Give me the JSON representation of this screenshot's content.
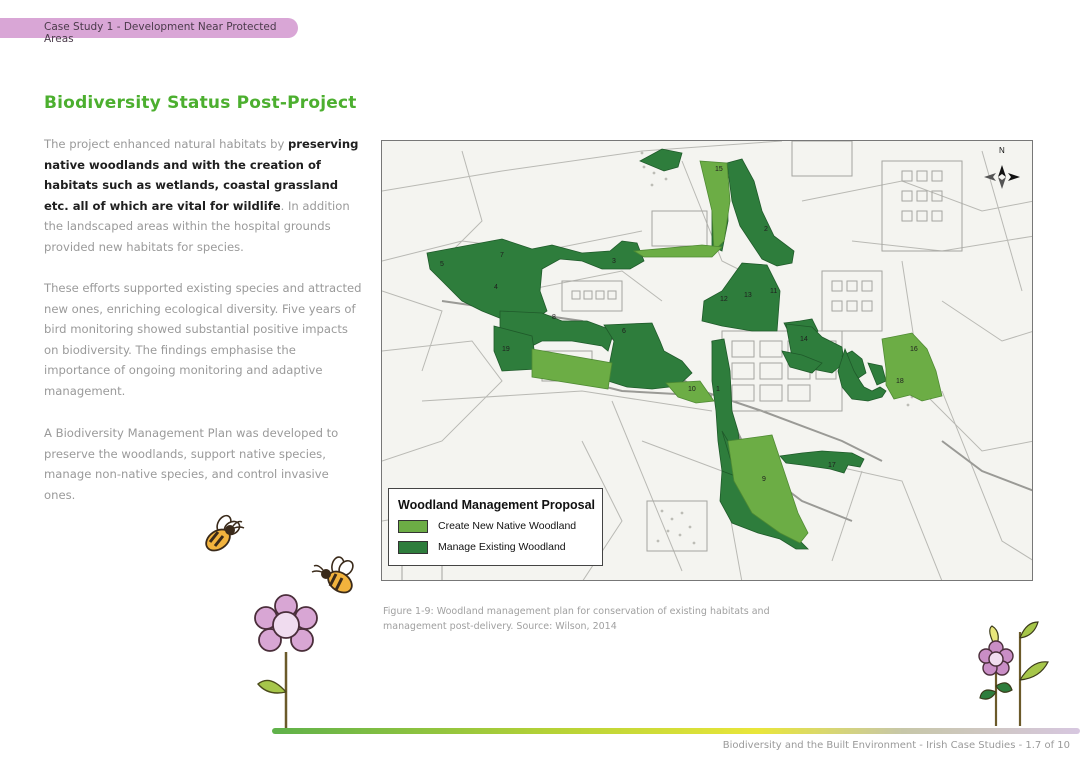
{
  "header": {
    "tab_label": "Case Study 1 - Development Near Protected Areas"
  },
  "content": {
    "heading": "Biodiversity Status Post-Project",
    "p1": {
      "a": "The project enhanced natural habitats by ",
      "b": "preserving native woodlands and with the creation of habitats such as wetlands, coastal grassland etc. all of which are vital for wildlife",
      "c": ". In addition the landscaped areas within the hospital grounds provided new habitats for species."
    },
    "p2": "These efforts supported existing species and attracted new ones, enriching ecological diversity. Five years of bird monitoring showed substantial positive impacts on biodiversity. The findings emphasise the importance of ongoing monitoring and adaptive management.",
    "p3": "A Biodiversity Management Plan was developed to preserve the woodlands, support native species, manage non-native species, and control invasive ones."
  },
  "map": {
    "north_label": "N",
    "legend": {
      "title": "Woodland Management Proposal",
      "items": [
        {
          "label": "Create New Native Woodland",
          "color": "#6cad45"
        },
        {
          "label": "Manage Existing Woodland",
          "color": "#2e7d3c"
        }
      ]
    },
    "area_numbers": [
      "15",
      "7",
      "5",
      "4",
      "8",
      "6",
      "3",
      "12",
      "13",
      "11",
      "2",
      "14",
      "16",
      "10",
      "1",
      "9",
      "17",
      "18",
      "19"
    ]
  },
  "caption": "Figure 1-9: Woodland management plan for conservation of existing habitats and management post-delivery. Source: Wilson, 2014",
  "footer": {
    "text": "Biodiversity and the Built Environment  -  Irish Case Studies  -  1.7 of 10"
  },
  "colors": {
    "accent_green": "#4caf2f",
    "tab_purple": "#d9a6d6",
    "new_woodland": "#6cad45",
    "existing_woodland": "#2e7d3c"
  }
}
